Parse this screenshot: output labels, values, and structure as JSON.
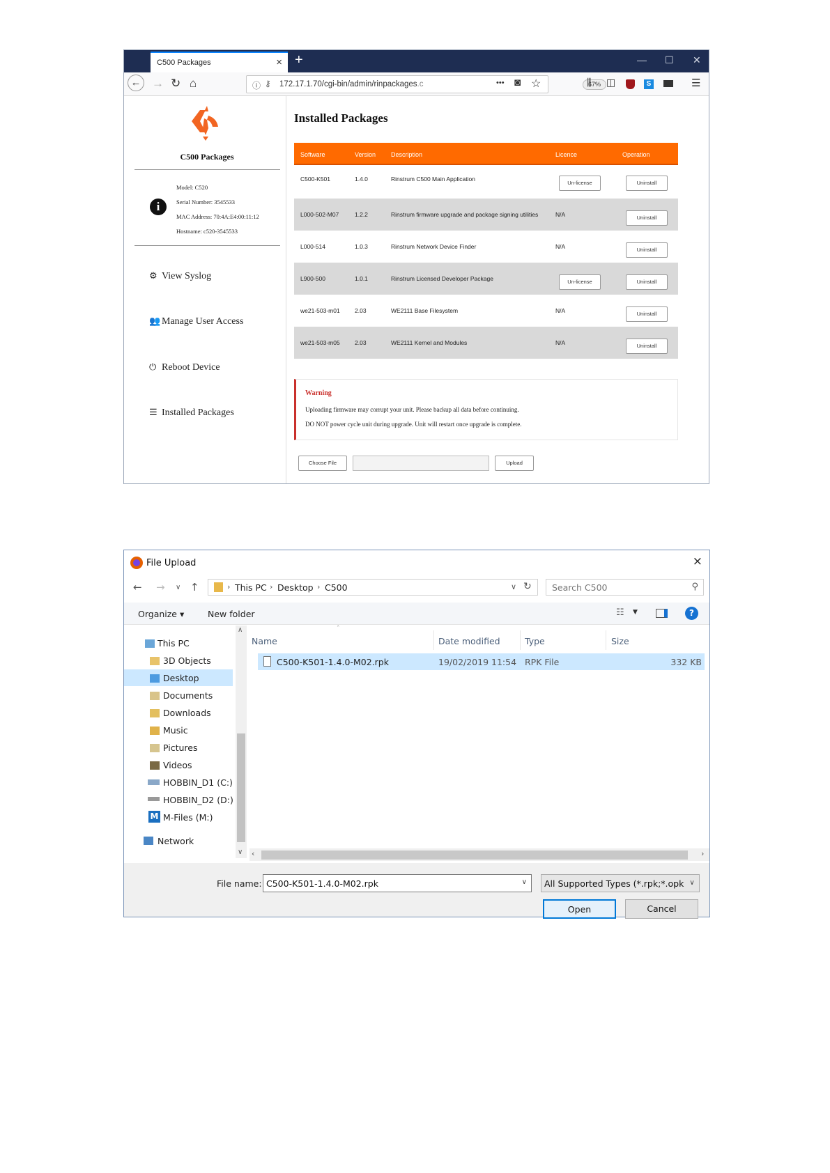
{
  "browser": {
    "tab_title": "C500 Packages",
    "tab_close": "×",
    "new_tab": "+",
    "url": "172.17.1.70/cgi-bin/admin/rinpackages",
    "url_tail": ".c",
    "zoom": "67%",
    "more": "•••"
  },
  "sidebar": {
    "title": "C500 Packages",
    "model": "Model: C520",
    "serial": "Serial Number: 3545533",
    "mac": "MAC Address: 70:4A:E4:00:11:12",
    "hostname": "Hostname: c520-3545533",
    "menu": [
      {
        "label": "View Syslog",
        "icon": "gears-icon"
      },
      {
        "label": "Manage User Access",
        "icon": "users-icon"
      },
      {
        "label": "Reboot Device",
        "icon": "power-icon"
      },
      {
        "label": "Installed Packages",
        "icon": "list-icon"
      }
    ]
  },
  "main": {
    "title": "Installed Packages",
    "headers": [
      "Software",
      "Version",
      "Description",
      "Licence",
      "Operation"
    ],
    "rows": [
      {
        "software": "C500-K501",
        "version": "1.4.0",
        "description": "Rinstrum C500 Main Application",
        "licence": "",
        "licence_button": "Un-license",
        "operation": "Uninstall"
      },
      {
        "software": "L000-502-M07",
        "version": "1.2.2",
        "description": "Rinstrum firmware upgrade and package signing utilities",
        "licence": "N/A",
        "licence_button": "",
        "operation": "Uninstall"
      },
      {
        "software": "L000-514",
        "version": "1.0.3",
        "description": "Rinstrum Network Device Finder",
        "licence": "N/A",
        "licence_button": "",
        "operation": "Uninstall"
      },
      {
        "software": "L900-500",
        "version": "1.0.1",
        "description": "Rinstrum Licensed Developer Package",
        "licence": "",
        "licence_button": "Un-license",
        "operation": "Uninstall"
      },
      {
        "software": "we21-503-m01",
        "version": "2.03",
        "description": "WE2111 Base Filesystem",
        "licence": "N/A",
        "licence_button": "",
        "operation": "Uninstall"
      },
      {
        "software": "we21-503-m05",
        "version": "2.03",
        "description": "WE2111 Kernel and Modules",
        "licence": "N/A",
        "licence_button": "",
        "operation": "Uninstall"
      }
    ],
    "warning": {
      "title": "Warning",
      "line1": "Uploading firmware may corrupt your unit. Please backup all data before continuing.",
      "line2": "DO NOT power cycle unit during upgrade. Unit will restart once upgrade is complete."
    },
    "choose_file": "Choose File",
    "upload": "Upload"
  },
  "dialog": {
    "title": "File Upload",
    "close": "×",
    "breadcrumb": [
      "This PC",
      "Desktop",
      "C500"
    ],
    "search_placeholder": "Search C500",
    "organize": "Organize ▾",
    "new_folder": "New folder",
    "nav_items": [
      {
        "label": "This PC",
        "icon": "pc-icon"
      },
      {
        "label": "3D Objects",
        "icon": "folder-icon"
      },
      {
        "label": "Desktop",
        "icon": "folder-icon"
      },
      {
        "label": "Documents",
        "icon": "folder-icon"
      },
      {
        "label": "Downloads",
        "icon": "folder-icon"
      },
      {
        "label": "Music",
        "icon": "folder-icon"
      },
      {
        "label": "Pictures",
        "icon": "folder-icon"
      },
      {
        "label": "Videos",
        "icon": "folder-icon"
      },
      {
        "label": "HOBBIN_D1 (C:)",
        "icon": "drive-icon"
      },
      {
        "label": "HOBBIN_D2 (D:)",
        "icon": "drive-icon"
      },
      {
        "label": "M-Files (M:)",
        "icon": "mfiles-icon"
      },
      {
        "label": "Network",
        "icon": "network-icon"
      }
    ],
    "columns": [
      "Name",
      "Date modified",
      "Type",
      "Size"
    ],
    "file": {
      "name": "C500-K501-1.4.0-M02.rpk",
      "date": "19/02/2019 11:54",
      "type": "RPK File",
      "size": "332 KB"
    },
    "file_name_label": "File name:",
    "file_name_value": "C500-K501-1.4.0-M02.rpk",
    "filter": "All Supported Types (*.rpk;*.opk",
    "open": "Open",
    "cancel": "Cancel"
  }
}
